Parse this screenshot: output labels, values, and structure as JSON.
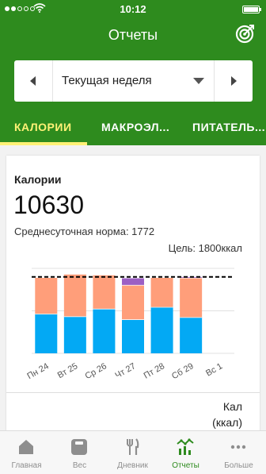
{
  "status_bar": {
    "time": "10:12"
  },
  "header": {
    "title": "Отчеты",
    "target_icon": "target-icon"
  },
  "week_selector": {
    "label": "Текущая неделя"
  },
  "tabs": [
    {
      "label": "КАЛОРИИ",
      "active": true
    },
    {
      "label": "МАКРОЭЛ..."
    },
    {
      "label": "ПИТАТЕЛЬ..."
    }
  ],
  "card": {
    "title": "Калории",
    "total": "10630",
    "avg": "Среднесуточная норма: 1772",
    "goal": "Цель: 1800ккал",
    "column_label_1": "Кал",
    "column_label_2": "(ккал)"
  },
  "chart_data": {
    "type": "bar",
    "stacked": true,
    "categories": [
      "Пн 24",
      "Вт 25",
      "Ср 26",
      "Чт 27",
      "Пт 28",
      "Сб 29",
      "Вс 1"
    ],
    "ylim": [
      0,
      2000
    ],
    "goal_line": 1800,
    "colors": {
      "bottom": "#03a9f4",
      "middle": "#ff9e7a",
      "top": "#9c5fc4",
      "goal": "#000000"
    },
    "series": [
      {
        "values": [
          930,
          870,
          1050,
          800,
          1090,
          850,
          0
        ]
      },
      {
        "values": [
          860,
          1000,
          800,
          810,
          700,
          930,
          0
        ]
      },
      {
        "values": [
          0,
          0,
          0,
          170,
          0,
          30,
          0
        ]
      }
    ]
  },
  "tabbar": [
    {
      "label": "Главная",
      "icon": "home-icon"
    },
    {
      "label": "Вес",
      "icon": "scale-icon"
    },
    {
      "label": "Дневник",
      "icon": "fork-knife-icon"
    },
    {
      "label": "Отчеты",
      "icon": "reports-icon",
      "active": true
    },
    {
      "label": "Больше",
      "icon": "more-icon"
    }
  ]
}
